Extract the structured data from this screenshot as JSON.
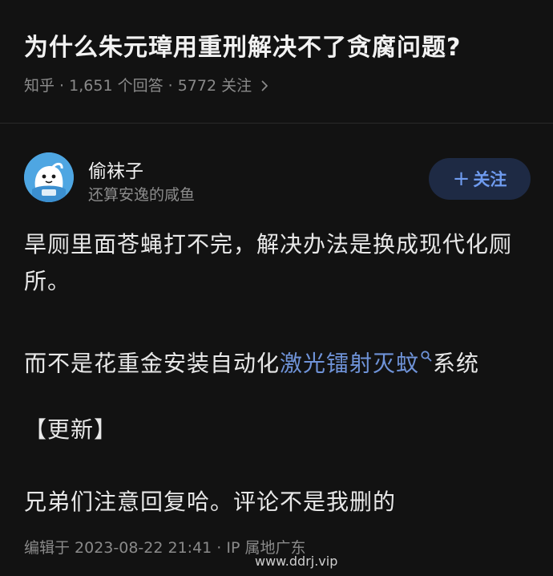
{
  "question": {
    "title": "为什么朱元璋用重刑解决不了贪腐问题?",
    "source": "知乎",
    "answers": "1,651 个回答",
    "follows": "5772 关注"
  },
  "author": {
    "name": "偷袜子",
    "bio": "还算安逸的咸鱼",
    "follow_label": "关注",
    "avatar_icon": "cartoon-face-avatar"
  },
  "answer": {
    "p1": "旱厕里面苍蝇打不完，解决办法是换成现代化厕所。",
    "p2_before": "而不是花重金安装自动化",
    "p2_link": "激光镭射灭蚊",
    "p2_after": "系统",
    "p3": "【更新】",
    "p4": "兄弟们注意回复哈。评论不是我删的"
  },
  "edit_info": "编辑于 2023-08-22 21:41 · IP 属地广东",
  "watermark": "www.ddrj.vip",
  "colors": {
    "background": "#121212",
    "link": "#6f93d8",
    "follow_button_bg": "#1e2a44",
    "follow_button_text": "#6f9bef"
  }
}
